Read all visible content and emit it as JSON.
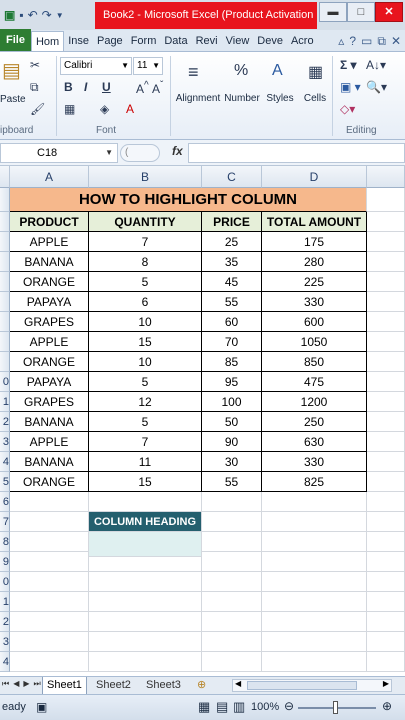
{
  "window": {
    "title": "Book2 - Microsoft Excel (Product Activation ...",
    "min": "▬",
    "max": "□",
    "close": "✕"
  },
  "tabs": [
    "File",
    "Hom",
    "Inse",
    "Page",
    "Form",
    "Data",
    "Revi",
    "View",
    "Deve",
    "Acro"
  ],
  "ribbon": {
    "font_name": "Calibri",
    "font_size": "11",
    "groups": {
      "clipboard": "ipboard",
      "font": "Font",
      "editing": "Editing"
    },
    "paste_label": "Paste",
    "alignment": "Alignment",
    "number": "Number",
    "styles": "Styles",
    "cells": "Cells"
  },
  "formula_bar": {
    "name_box": "C18",
    "fx": "fx",
    "formula": ""
  },
  "columns": [
    "A",
    "B",
    "C",
    "D"
  ],
  "sheet": {
    "title": "HOW TO HIGHLIGHT COLUMN",
    "headers": [
      "PRODUCT",
      "QUANTITY",
      "PRICE",
      "TOTAL AMOUNT"
    ],
    "rows": [
      [
        "APPLE",
        "7",
        "25",
        "175"
      ],
      [
        "BANANA",
        "8",
        "35",
        "280"
      ],
      [
        "ORANGE",
        "5",
        "45",
        "225"
      ],
      [
        "PAPAYA",
        "6",
        "55",
        "330"
      ],
      [
        "GRAPES",
        "10",
        "60",
        "600"
      ],
      [
        "APPLE",
        "15",
        "70",
        "1050"
      ],
      [
        "ORANGE",
        "10",
        "85",
        "850"
      ],
      [
        "PAPAYA",
        "5",
        "95",
        "475"
      ],
      [
        "GRAPES",
        "12",
        "100",
        "1200"
      ],
      [
        "BANANA",
        "5",
        "50",
        "250"
      ],
      [
        "APPLE",
        "7",
        "90",
        "630"
      ],
      [
        "BANANA",
        "11",
        "30",
        "330"
      ],
      [
        "ORANGE",
        "15",
        "55",
        "825"
      ]
    ],
    "column_heading_label": "COLUMN HEADING",
    "row_numbers": [
      "",
      "",
      "",
      "",
      "",
      "",
      "",
      "",
      "",
      "0",
      "1",
      "2",
      "3",
      "4",
      "5",
      "6",
      "7",
      "8",
      "9",
      "0",
      "1",
      "2",
      "3",
      "4"
    ]
  },
  "sheet_tabs": [
    "Sheet1",
    "Sheet2",
    "Sheet3"
  ],
  "status": {
    "ready": "eady",
    "zoom": "100%"
  },
  "colors": {
    "title_bg": "#f6b88c",
    "header_bg": "#e6efd9",
    "dark_teal": "#245f6e",
    "light_teal": "#dff0f0",
    "title_red": "#e8141d"
  }
}
